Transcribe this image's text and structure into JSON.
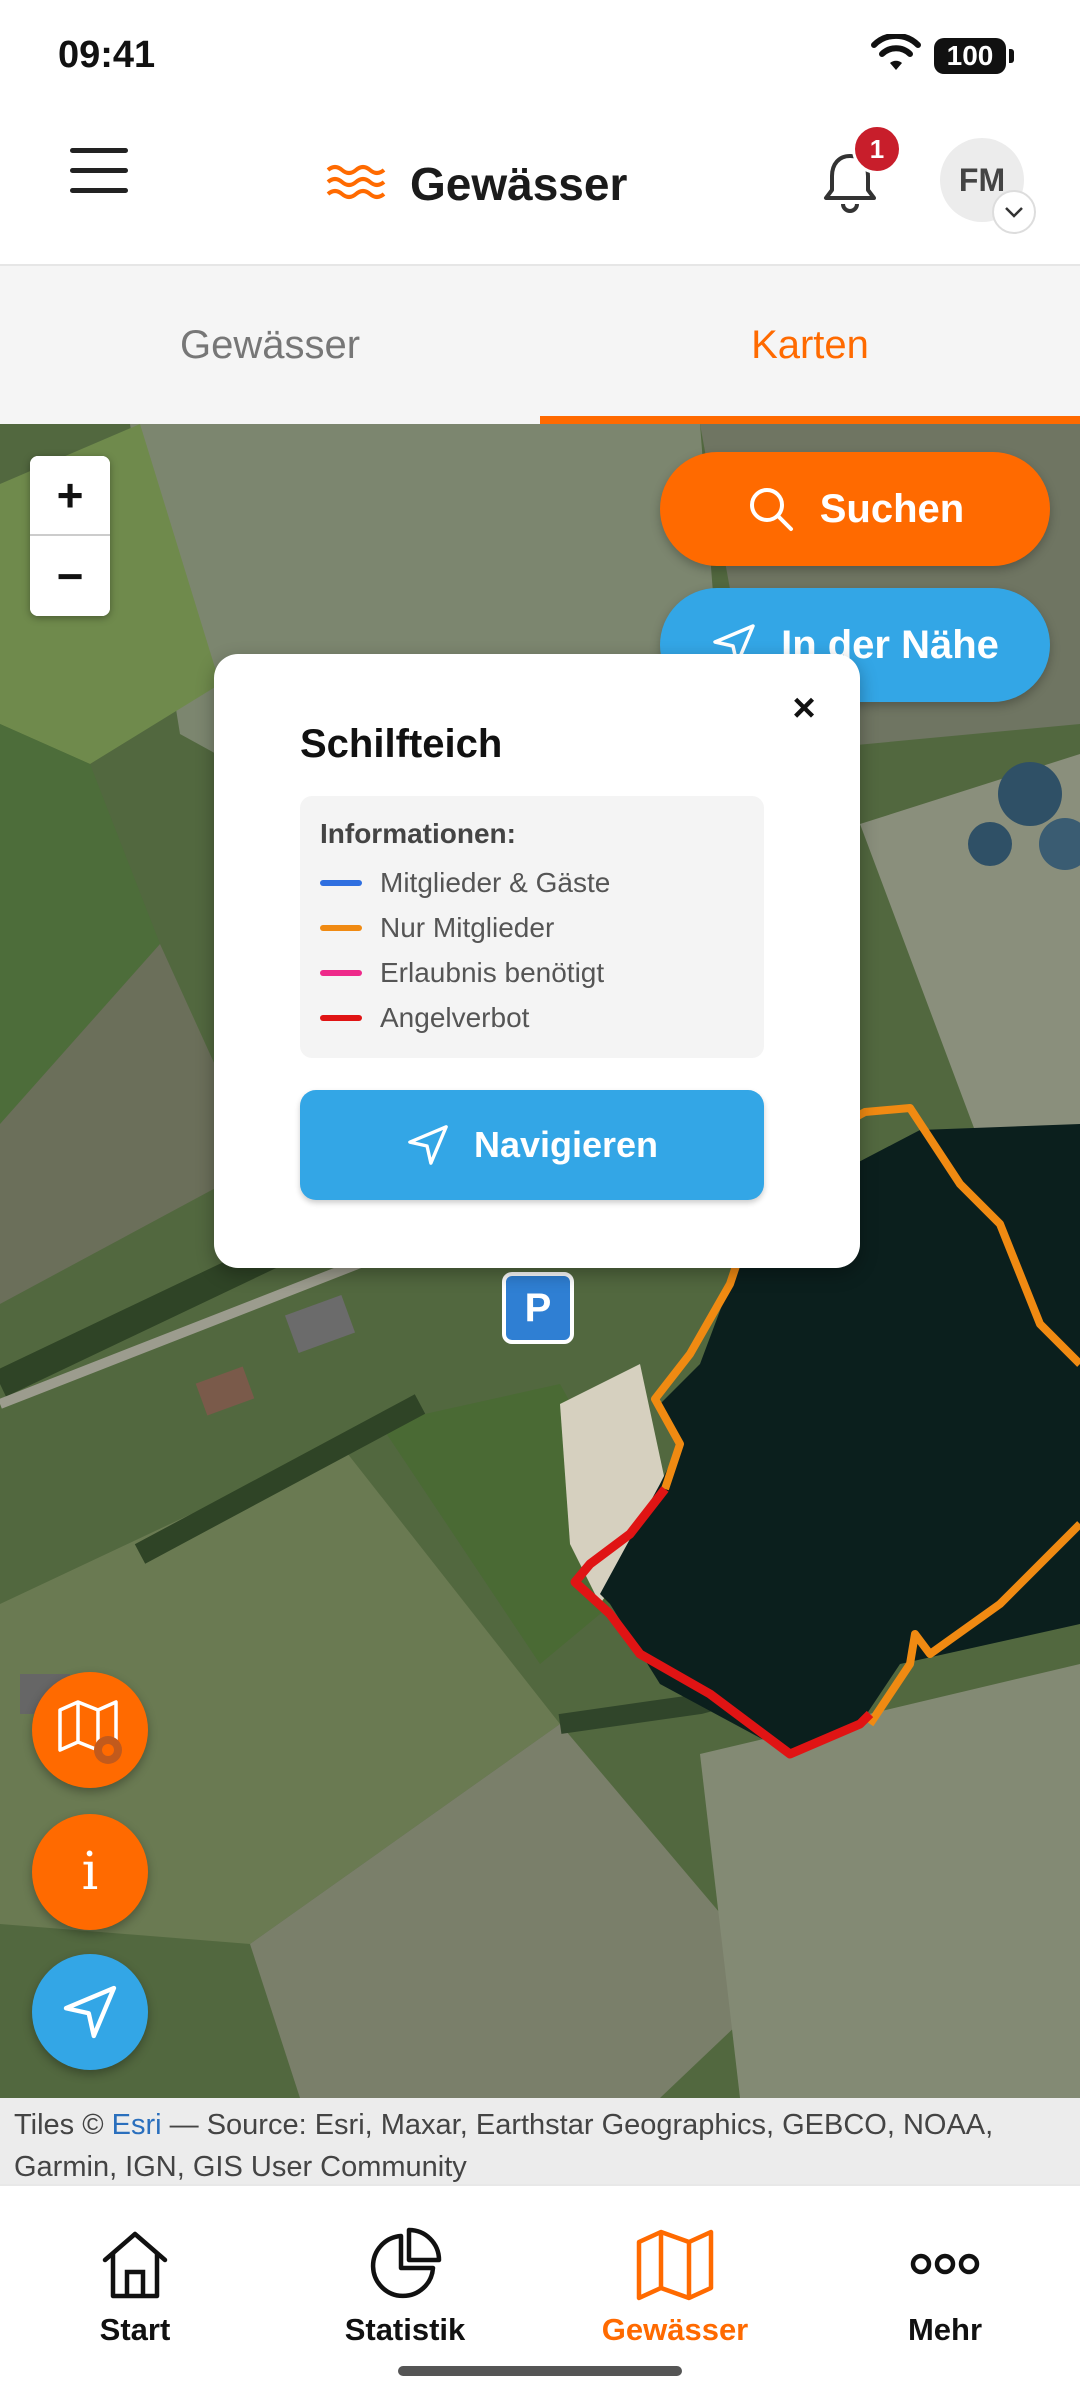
{
  "status_bar": {
    "time": "09:41",
    "battery": "100"
  },
  "header": {
    "title": "Gewässer",
    "notification_count": "1",
    "avatar_initials": "FM"
  },
  "tabs": [
    {
      "label": "Gewässer",
      "active": false
    },
    {
      "label": "Karten",
      "active": true
    }
  ],
  "map": {
    "zoom_in": "+",
    "zoom_out": "−",
    "search_label": "Suchen",
    "nearby_label": "In der Nähe",
    "parking_label": "P",
    "popup": {
      "close": "×",
      "title": "Schilfteich",
      "legend_heading": "Informationen:",
      "legend": [
        {
          "label": "Mitglieder & Gäste",
          "color": "#2f6fe0"
        },
        {
          "label": "Nur Mitglieder",
          "color": "#f08a12"
        },
        {
          "label": "Erlaubnis benötigt",
          "color": "#ee2a8a"
        },
        {
          "label": "Angelverbot",
          "color": "#e01414"
        }
      ],
      "navigate_label": "Navigieren"
    },
    "info_fab": "i",
    "attribution": {
      "prefix": "Tiles © ",
      "link": "Esri",
      "suffix": " — Source: Esri, Maxar, Earthstar Geographics, GEBCO, NOAA, Garmin, IGN, GIS User Community"
    }
  },
  "bottom_nav": [
    {
      "label": "Start",
      "icon": "home-icon",
      "active": false
    },
    {
      "label": "Statistik",
      "icon": "pie-chart-icon",
      "active": false
    },
    {
      "label": "Gewässer",
      "icon": "map-icon",
      "active": true
    },
    {
      "label": "Mehr",
      "icon": "more-icon",
      "active": false
    }
  ],
  "colors": {
    "accent": "#ff6a00",
    "secondary": "#33a6e6",
    "badge": "#c81e2b"
  }
}
